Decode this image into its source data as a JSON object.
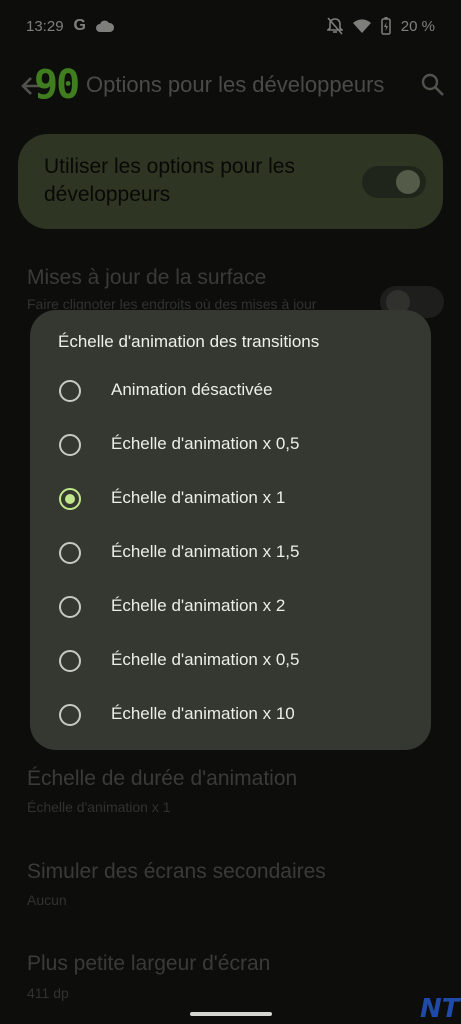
{
  "status_bar": {
    "time": "13:29",
    "carrier_glyph": "G",
    "battery": "20 %"
  },
  "app_bar": {
    "fps": "90",
    "title": "Options pour les développeurs"
  },
  "dev_toggle": {
    "label": "Utiliser les options pour les développeurs",
    "on": true
  },
  "settings": [
    {
      "title": "Mises à jour de la surface",
      "subtitle": "Faire clignoter les endroits où des mises à jour"
    },
    {
      "title": "Échelle de durée d'animation",
      "subtitle": "Échelle d'animation x 1"
    },
    {
      "title": "Simuler des écrans secondaires",
      "subtitle": "Aucun"
    },
    {
      "title": "Plus petite largeur d'écran",
      "subtitle": "411 dp"
    }
  ],
  "dialog": {
    "title": "Échelle d'animation des transitions",
    "options": [
      {
        "label": "Animation désactivée",
        "selected": false
      },
      {
        "label": "Échelle d'animation x 0,5",
        "selected": false
      },
      {
        "label": "Échelle d'animation x 1",
        "selected": true
      },
      {
        "label": "Échelle d'animation x 1,5",
        "selected": false
      },
      {
        "label": "Échelle d'animation x 2",
        "selected": false
      },
      {
        "label": "Échelle d'animation x 0,5",
        "selected": false
      },
      {
        "label": "Échelle d'animation x 10",
        "selected": false
      }
    ]
  },
  "watermark": "NT",
  "colors": {
    "accent": "#bfe78a",
    "card": "#8ca46a",
    "dialog_bg": "#353731"
  }
}
